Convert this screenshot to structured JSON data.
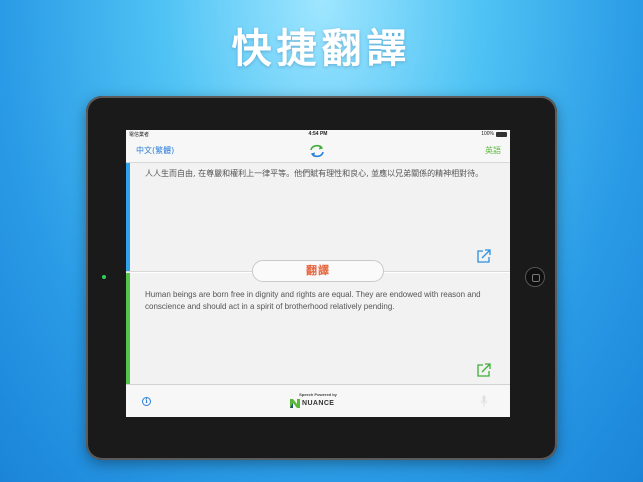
{
  "headline": "快捷翻譯",
  "device": {
    "statusbar": {
      "carrier": "電信業者 ",
      "time": "4:54 PM",
      "battery": "100%"
    },
    "navbar": {
      "source_language": "中文(繁體)",
      "target_language": "英語"
    },
    "source_panel": {
      "text": "人人生而自由, 在尊嚴和權利上一律平等。他們賦有理性和良心, 並應以兄弟關係的精神相對待。"
    },
    "translate_button": "翻譯",
    "target_panel": {
      "text": "Human beings are born free in dignity and rights are equal. They are endowed with reason and conscience and should act in a spirit of brotherhood relatively pending."
    },
    "toolbar": {
      "info_icon": "i",
      "powered_by": "Speech Powered by",
      "brand": "NUANCE"
    }
  },
  "colors": {
    "accent_blue": "#2a7fd9",
    "source_bar": "#2fa3ee",
    "target_bar": "#56c34a",
    "translate_text": "#e5663f"
  },
  "icons": [
    "swap-icon",
    "share-icon",
    "info-icon",
    "nuance-logo-icon",
    "microphone-icon",
    "battery-icon"
  ]
}
